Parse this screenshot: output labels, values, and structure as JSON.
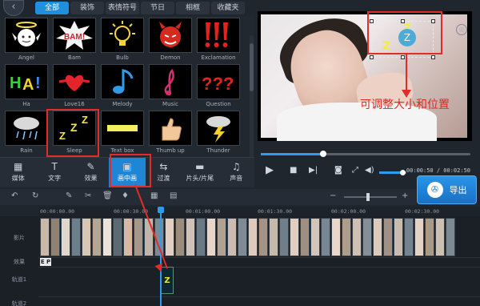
{
  "tabs": [
    "全部",
    "装饰",
    "表情符号",
    "节日",
    "相框",
    "收藏夹"
  ],
  "library": {
    "row1": [
      {
        "label": "Angel",
        "icon": "angel-icon"
      },
      {
        "label": "Bam",
        "icon": "bam-icon"
      },
      {
        "label": "Bulb",
        "icon": "bulb-icon"
      },
      {
        "label": "Demon",
        "icon": "demon-icon"
      },
      {
        "label": "Exclamation",
        "icon": "exclamation-icon"
      }
    ],
    "row2": [
      {
        "label": "Ha",
        "icon": "ha-icon"
      },
      {
        "label": "Love16",
        "icon": "love-icon"
      },
      {
        "label": "Melody",
        "icon": "melody-icon"
      },
      {
        "label": "Music",
        "icon": "music-icon"
      },
      {
        "label": "Question",
        "icon": "question-icon"
      }
    ],
    "row3": [
      {
        "label": "Rain",
        "icon": "rain-icon"
      },
      {
        "label": "Sleep",
        "icon": "sleep-icon"
      },
      {
        "label": "Text box",
        "icon": "textbox-icon"
      },
      {
        "label": "Thumb up",
        "icon": "thumb-up-icon"
      },
      {
        "label": "Thunder",
        "icon": "thunder-icon"
      }
    ]
  },
  "tools": [
    "媒体",
    "文字",
    "效果",
    "画中画",
    "过渡",
    "片头/片尾",
    "声音"
  ],
  "preview": {
    "annotation": "可调整大小和位置",
    "sticker_text": "Z"
  },
  "player": {
    "time": "00:00:50 / 00:02:50",
    "progress_fraction": 0.3,
    "volume_fraction": 0.8
  },
  "export_label": "导出",
  "timeline": {
    "ruler": [
      "00:00:00.00",
      "00:00:30.00",
      "00:01:00.00",
      "00:01:30.00",
      "00:02:00.00",
      "00:02:30.00"
    ],
    "track_labels": [
      "影片",
      "效果",
      "轨道1",
      "轨道2"
    ],
    "fx_mark": "E P",
    "clip_text": "Z"
  },
  "colors": {
    "accent": "#1f8fe0",
    "annotation_red": "#e32b2b"
  }
}
